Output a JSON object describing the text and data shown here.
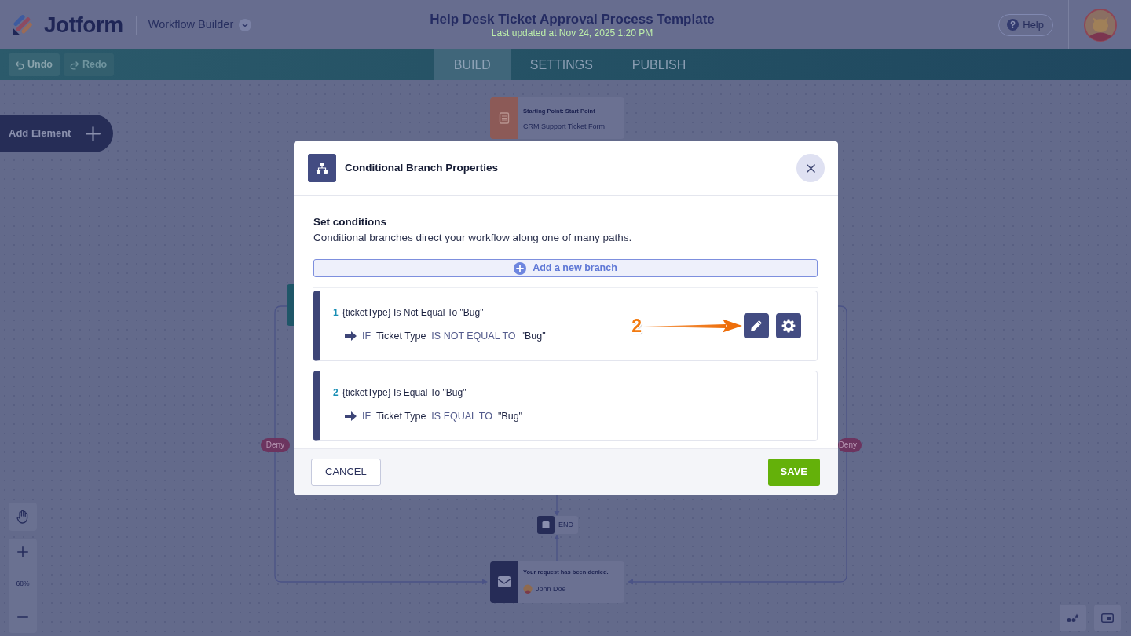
{
  "header": {
    "logo": "Jotform",
    "app_switcher": "Workflow Builder",
    "title": "Help Desk Ticket Approval Process Template",
    "subtitle": "Last updated at Nov 24, 2025 1:20 PM",
    "help": "Help"
  },
  "toolbar": {
    "history": [
      {
        "kind": "undo",
        "label": "Undo",
        "disabled": false
      },
      {
        "kind": "redo",
        "label": "Redo",
        "disabled": true
      }
    ],
    "tabs": [
      {
        "label": "BUILD",
        "selected": true
      },
      {
        "label": "SETTINGS",
        "selected": false
      },
      {
        "label": "PUBLISH",
        "selected": false
      }
    ]
  },
  "canvas": {
    "add_element": "Add Element",
    "zoom_level": "68%",
    "nodes": [
      {
        "kind": "start",
        "title": "Starting Point: Start Point",
        "subtitle": "CRM Support Ticket Form"
      },
      {
        "kind": "end",
        "label": "END"
      },
      {
        "kind": "email",
        "title": "Your request has been denied.",
        "assignee": "John Doe"
      }
    ],
    "edge_labels": [
      {
        "label": "Deny"
      },
      {
        "label": "Deny"
      }
    ]
  },
  "dialog": {
    "title": "Conditional Branch Properties",
    "section_title": "Set conditions",
    "description": "Conditional branches direct your workflow along one of many paths.",
    "add_branch": "Add a new branch",
    "branches": [
      {
        "number": "1",
        "summary": "{ticketType} Is Not Equal To \"Bug\"",
        "condition": {
          "keyword": "IF",
          "field": "Ticket Type",
          "operator": "IS NOT EQUAL TO",
          "value": "\"Bug\""
        },
        "callout": "2",
        "actions_shown": true
      },
      {
        "number": "2",
        "summary": "{ticketType} Is Equal To \"Bug\"",
        "condition": {
          "keyword": "IF",
          "field": "Ticket Type",
          "operator": "IS EQUAL TO",
          "value": "\"Bug\""
        },
        "actions_shown": false
      }
    ],
    "cancel": "CANCEL",
    "save": "SAVE"
  }
}
